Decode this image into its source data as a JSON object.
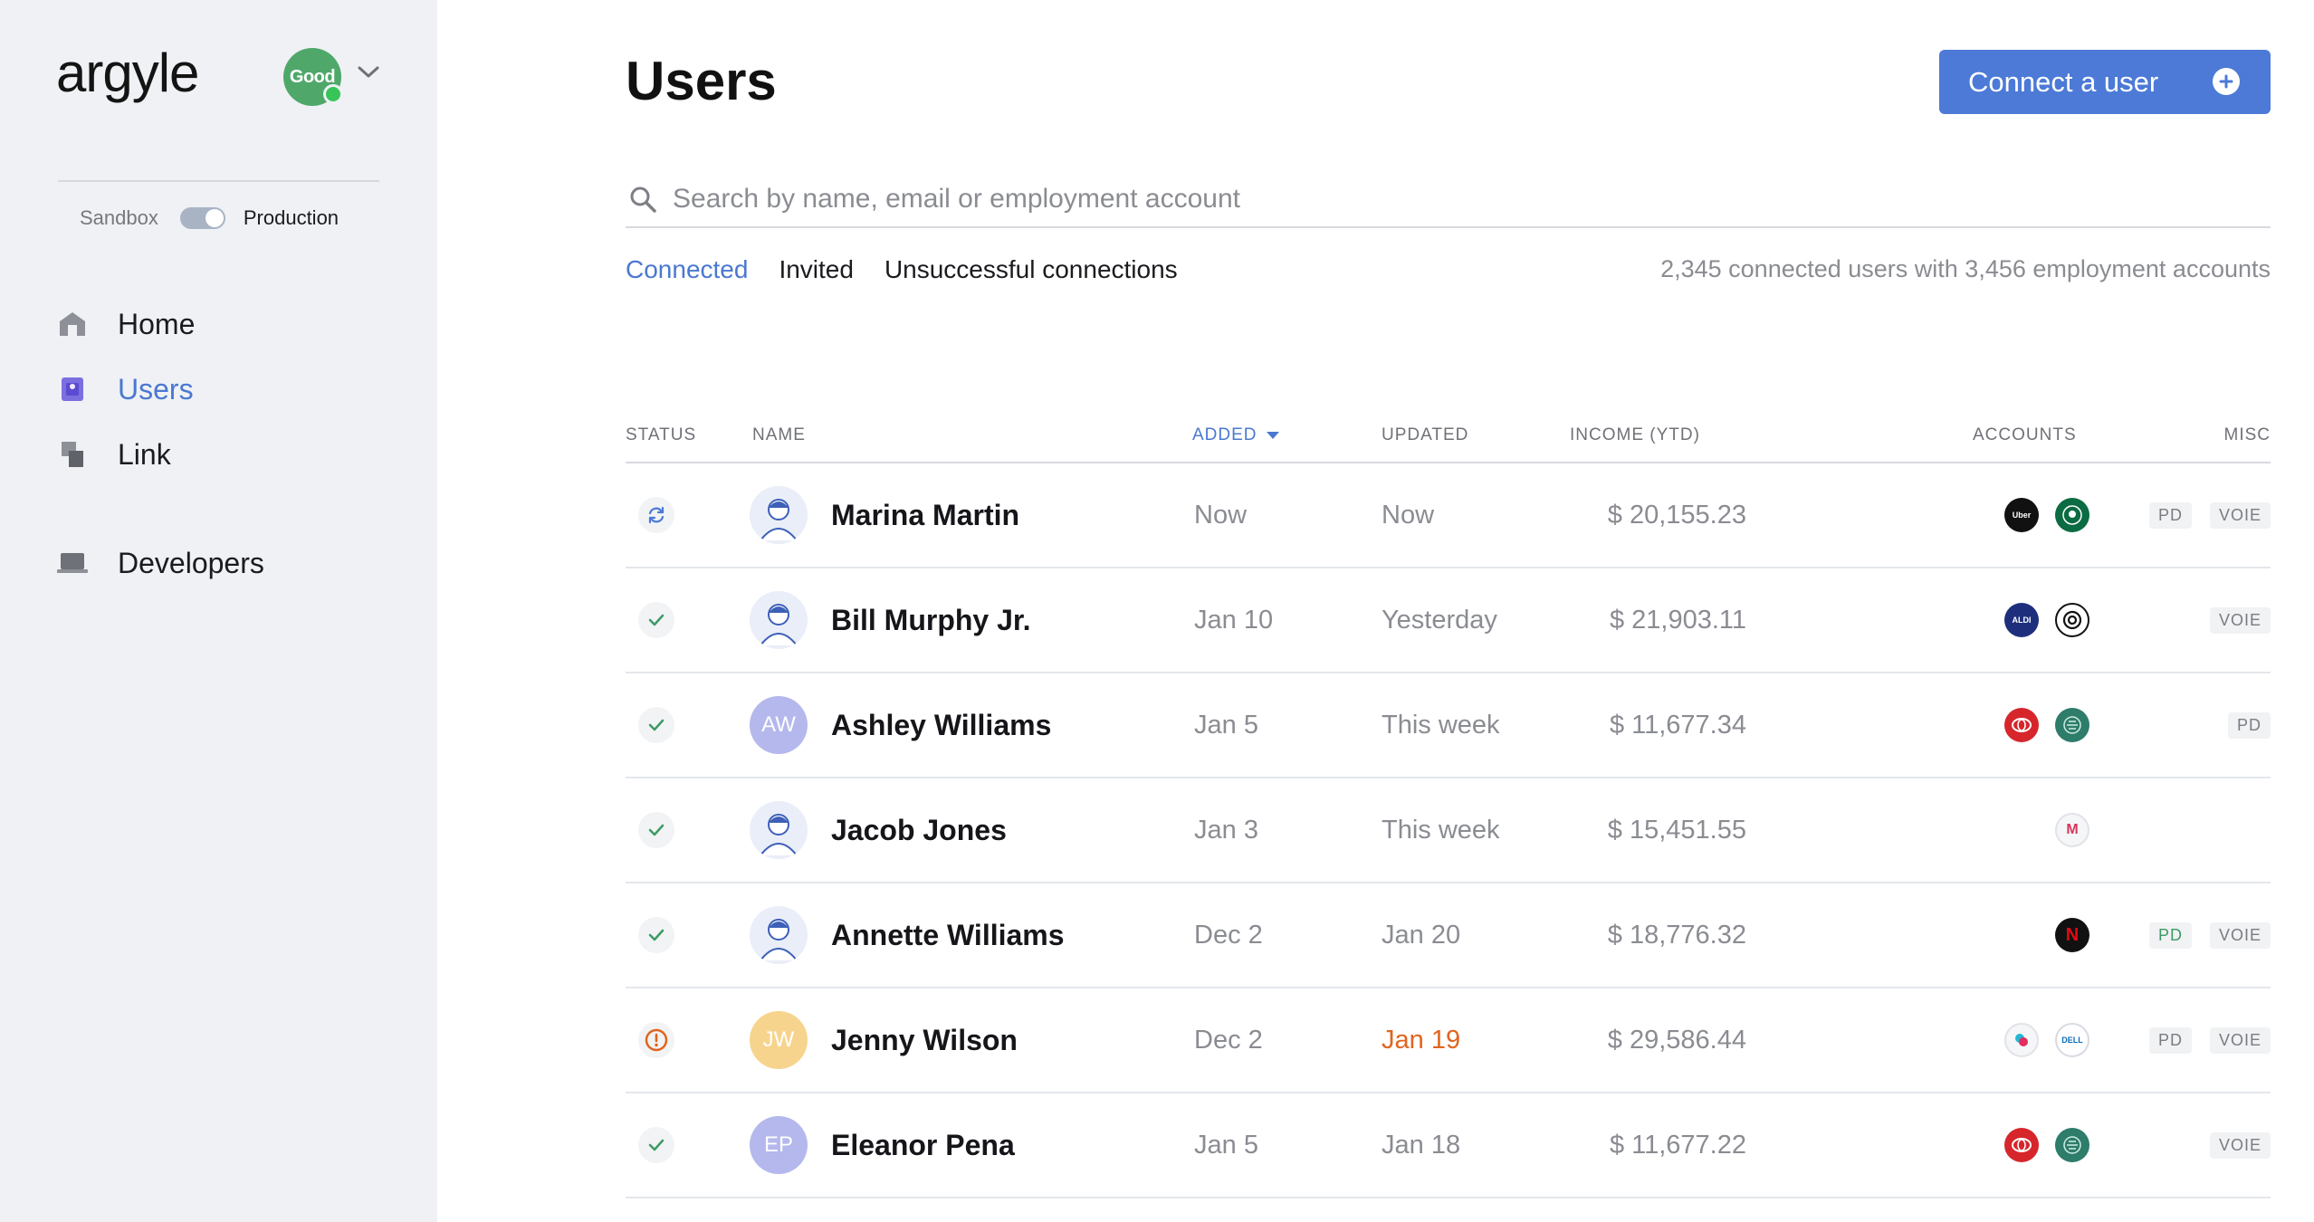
{
  "sidebar": {
    "logo": "argyle",
    "org_badge": "Good",
    "env": {
      "sandbox_label": "Sandbox",
      "production_label": "Production"
    },
    "nav": [
      {
        "label": "Home",
        "icon": "home-icon",
        "active": false
      },
      {
        "label": "Users",
        "icon": "users-icon",
        "active": true
      },
      {
        "label": "Link",
        "icon": "link-icon",
        "active": false
      },
      {
        "label": "Developers",
        "icon": "laptop-icon",
        "active": false
      }
    ]
  },
  "header": {
    "title": "Users",
    "connect_button": "Connect a user"
  },
  "search": {
    "placeholder": "Search by name, email or employment account"
  },
  "tabs": [
    {
      "label": "Connected",
      "active": true
    },
    {
      "label": "Invited",
      "active": false
    },
    {
      "label": "Unsuccessful connections",
      "active": false
    }
  ],
  "summary": "2,345 connected users with 3,456 employment accounts",
  "table": {
    "columns": {
      "status": "Status",
      "name": "Name",
      "added": "Added",
      "updated": "Updated",
      "income": "Income (YTD)",
      "accounts": "Accounts",
      "misc": "Misc"
    },
    "rows": [
      {
        "status": "syncing",
        "name": "Marina Martin",
        "avatar": "photo",
        "added": "Now",
        "updated": "Now",
        "updated_warn": false,
        "income": "$ 20,155.23",
        "accounts": [
          "Uber",
          "Starbucks"
        ],
        "misc": [
          "PD",
          "VOIE"
        ]
      },
      {
        "status": "ok",
        "name": "Bill Murphy Jr.",
        "avatar": "photo",
        "added": "Jan 10",
        "updated": "Yesterday",
        "updated_warn": false,
        "income": "$ 21,903.11",
        "accounts": [
          "ALDI",
          "Spiral"
        ],
        "misc": [
          "VOIE"
        ]
      },
      {
        "status": "ok",
        "name": "Ashley Williams",
        "avatar": "AW",
        "avatar_color": "#b4b8ec",
        "added": "Jan 5",
        "updated": "This week",
        "updated_warn": false,
        "income": "$ 11,677.34",
        "accounts": [
          "Toyota",
          "Leaf"
        ],
        "misc": [
          "PD"
        ]
      },
      {
        "status": "ok",
        "name": "Jacob Jones",
        "avatar": "photo",
        "added": "Jan 3",
        "updated": "This week",
        "updated_warn": false,
        "income": "$ 15,451.55",
        "accounts": [
          "M"
        ],
        "misc": []
      },
      {
        "status": "ok",
        "name": "Annette Williams",
        "avatar": "photo",
        "added": "Dec 2",
        "updated": "Jan 20",
        "updated_warn": false,
        "income": "$ 18,776.32",
        "accounts": [
          "Netflix"
        ],
        "misc": [
          "PD",
          "VOIE"
        ],
        "misc_green": [
          "PD"
        ]
      },
      {
        "status": "error",
        "name": "Jenny Wilson",
        "avatar": "JW",
        "avatar_color": "#f7d48d",
        "added": "Dec 2",
        "updated": "Jan 19",
        "updated_warn": true,
        "income": "$ 29,586.44",
        "accounts": [
          "Multi",
          "DELL"
        ],
        "misc": [
          "PD",
          "VOIE"
        ]
      },
      {
        "status": "ok",
        "name": "Eleanor Pena",
        "avatar": "EP",
        "avatar_color": "#b4b8ec",
        "added": "Jan 5",
        "updated": "Jan 18",
        "updated_warn": false,
        "income": "$ 11,677.22",
        "accounts": [
          "Toyota",
          "Leaf"
        ],
        "misc": [
          "VOIE"
        ]
      }
    ]
  },
  "colors": {
    "accent": "#4c7ad6",
    "warning": "#e0651e",
    "success": "#3d9a64"
  }
}
